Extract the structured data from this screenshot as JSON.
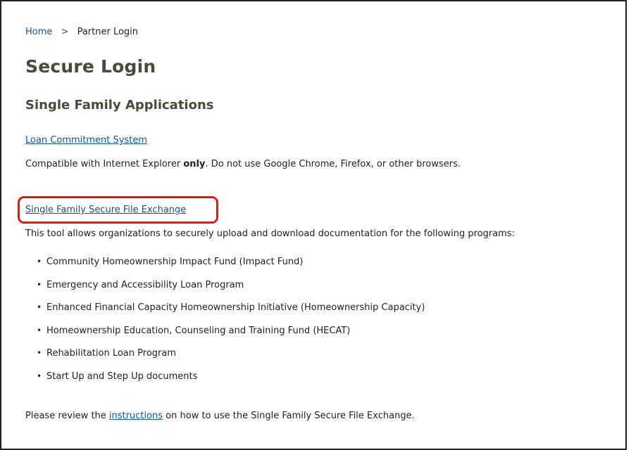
{
  "breadcrumb": {
    "home": "Home",
    "separator": ">",
    "current": "Partner Login"
  },
  "page_title": "Secure Login",
  "section_title": "Single Family Applications",
  "loan_commitment": {
    "link": "Loan Commitment System",
    "note_prefix": "Compatible with Internet Explorer ",
    "note_bold": "only",
    "note_suffix": ". Do not use Google Chrome, Firefox, or other browsers."
  },
  "secure_file_exchange": {
    "link": "Single Family Secure File Exchange",
    "description": "This tool allows organizations to securely upload and download documentation for the following programs:",
    "highlight_color": "#e8141b"
  },
  "programs": [
    "Community Homeownership Impact Fund (Impact Fund)",
    "Emergency and Accessibility Loan Program",
    "Enhanced Financial Capacity Homeownership Initiative (Homeownership Capacity)",
    "Homeownership Education, Counseling and Training Fund (HECAT)",
    "Rehabilitation Loan Program",
    "Start Up and Step Up documents"
  ],
  "review": {
    "prefix": "Please review the ",
    "link": "instructions",
    "suffix": " on how to use the Single Family Secure File Exchange."
  },
  "colors": {
    "link": "#1c4f91",
    "heading": "#4a4a3a"
  }
}
